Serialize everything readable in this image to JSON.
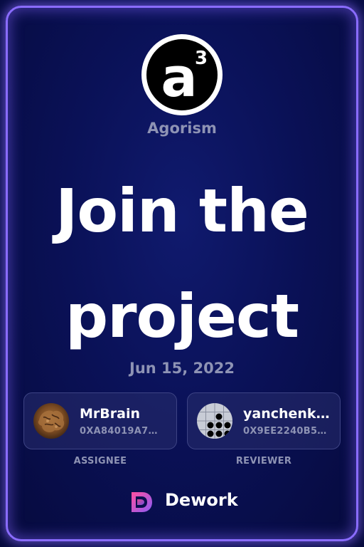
{
  "project": {
    "name": "Agorism",
    "logo_text": "a",
    "logo_superscript": "3"
  },
  "headline": {
    "line1": "Join the",
    "line2": "project"
  },
  "date": "Jun 15, 2022",
  "assignee": {
    "name": "MrBrain",
    "address": "0XA84019A7…",
    "role": "ASSIGNEE"
  },
  "reviewer": {
    "name": "yanchenk…",
    "address": "0X9EE2240B5…",
    "role": "REVIEWER"
  },
  "brand": {
    "name": "Dework"
  },
  "colors": {
    "frame": "#8a6cff",
    "background": "#0a1157",
    "muted_text": "#8e93b4",
    "brand_gradient_start": "#ff4fa0",
    "brand_gradient_end": "#8b5cf6"
  }
}
